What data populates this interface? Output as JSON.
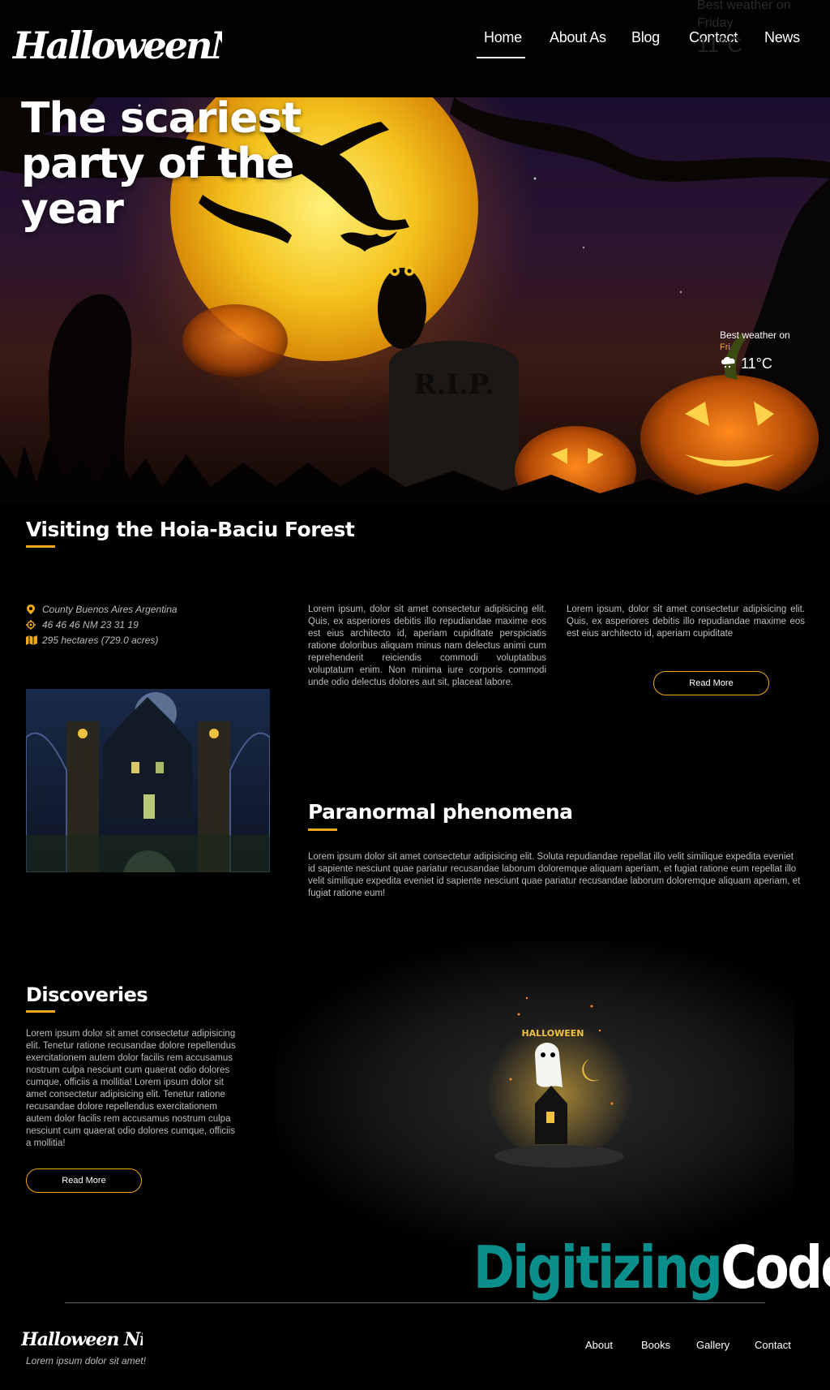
{
  "brand": {
    "name": "HalloweenNight"
  },
  "nav": {
    "items": [
      {
        "label": "Home",
        "active": true
      },
      {
        "label": "About As"
      },
      {
        "label": "Blog"
      },
      {
        "label": "Contact"
      },
      {
        "label": "News"
      }
    ]
  },
  "header_weather": {
    "label": "Best weather on",
    "day": "Friday",
    "temp": "11°C"
  },
  "hero": {
    "title": "The scariest party of the year",
    "weather": {
      "label": "Best weather on",
      "day": "Fri",
      "temp": "11°C",
      "icon": "cloud-snow-icon"
    },
    "tombstone_text": "R.I.P."
  },
  "forest": {
    "heading": "Visiting the Hoia-Baciu Forest",
    "location": "County Buenos Aires Argentina",
    "coordinates": "46 46 46 NM 23 31 19",
    "area": "295 hectares (729.0 acres)",
    "col1": "Lorem ipsum, dolor sit amet consectetur adipisicing elit. Quis, ex asperiores debitis illo repudiandae maxime eos est eius architecto id, aperiam cupiditate perspiciatis ratione doloribus aliquam minus nam delectus animi cum reprehenderit reiciendis commodi voluptatibus voluptatum enim. Non minima iure corporis commodi unde odio delectus dolores aut sit, placeat labore.",
    "col2": "Lorem ipsum, dolor sit amet consectetur adipisicing elit. Quis, ex asperiores debitis illo repudiandae maxime eos est eius architecto id, aperiam cupiditate",
    "read_more": "Read More"
  },
  "paranormal": {
    "heading": "Paranormal phenomena",
    "text": "Lorem ipsum dolor sit amet consectetur adipisicing elit. Soluta repudiandae repellat illo velit similique expedita eveniet id sapiente nesciunt quae pariatur recusandae laborum doloremque aliquam aperiam, et fugiat ratione eum repellat illo velit similique expedita eveniet id sapiente nesciunt quae pariatur recusandae laborum doloremque aliquam aperiam, et fugiat ratione eum!"
  },
  "discoveries": {
    "heading": "Discoveries",
    "text": "Lorem ipsum dolor sit amet consectetur adipisicing elit. Tenetur ratione recusandae dolore repellendus exercitationem autem dolor facilis rem accusamus nostrum culpa nesciunt cum quaerat odio dolores cumque, officiis a mollitia! Lorem ipsum dolor sit amet consectetur adipisicing elit. Tenetur ratione recusandae dolore repellendus exercitationem autem dolor facilis rem accusamus nostrum culpa nesciunt cum quaerat odio dolores cumque, officiis a mollitia!",
    "read_more": "Read More",
    "poster_text": "HALLOWEEN"
  },
  "watermark": {
    "part1": "Digitizing",
    "part2": "Code"
  },
  "footer": {
    "brand": "Halloween Night",
    "tagline": "Lorem ipsum dolor sit amet!",
    "links": [
      "About",
      "Books",
      "Gallery",
      "Contact"
    ]
  },
  "colors": {
    "accent": "#f0a818",
    "background": "#000000",
    "watermark_teal": "#0a8f8c"
  }
}
